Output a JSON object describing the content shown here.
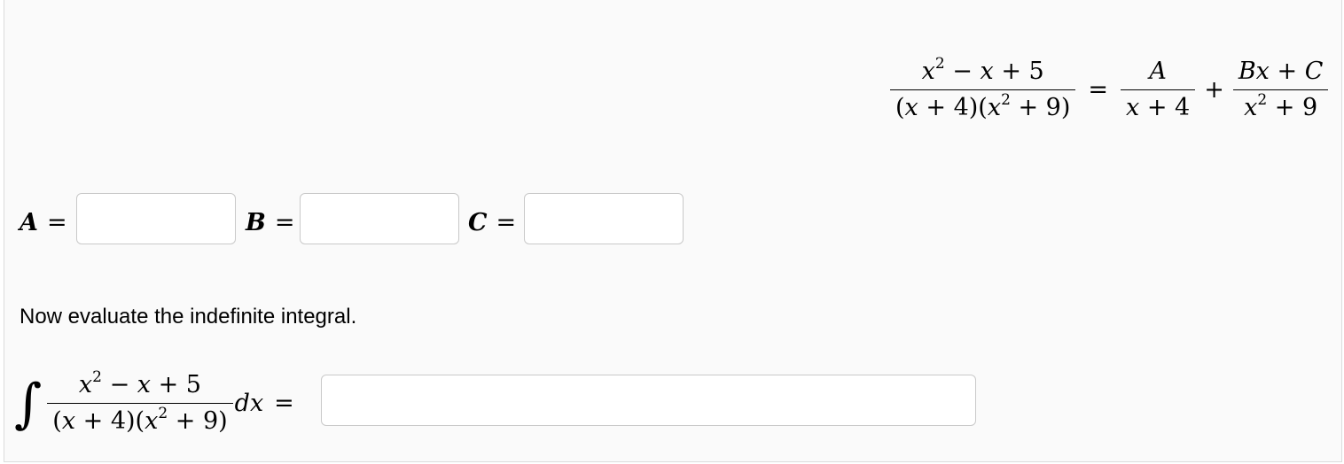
{
  "decomposition": {
    "lhs_num": "x² − x + 5",
    "lhs_den": "(x + 4)(x² + 9)",
    "equals": "=",
    "term1_num": "A",
    "term1_den": "x + 4",
    "plus": "+",
    "term2_num": "Bx + C",
    "term2_den": "x² + 9"
  },
  "answers": {
    "a_label": "A",
    "b_label": "B",
    "c_label": "C",
    "eq": "="
  },
  "instructions": "Now evaluate the indefinite integral.",
  "integral": {
    "sign": "∫",
    "num": "x² − x + 5",
    "den": "(x + 4)(x² + 9)",
    "dx": "dx",
    "eq": "="
  }
}
